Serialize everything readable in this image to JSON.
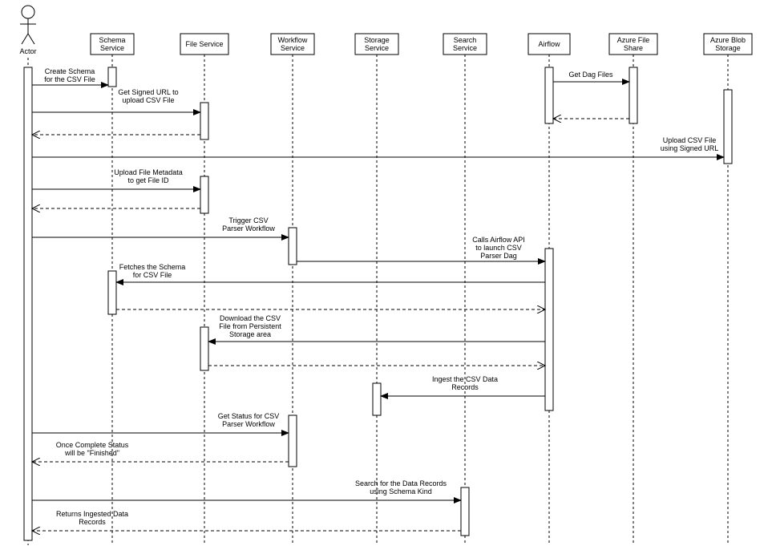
{
  "participants": {
    "actor": {
      "label1": "Actor",
      "label2": ""
    },
    "schema": {
      "label1": "Schema",
      "label2": "Service"
    },
    "file": {
      "label1": "File Service",
      "label2": ""
    },
    "workflow": {
      "label1": "Workflow",
      "label2": "Service"
    },
    "storage": {
      "label1": "Storage",
      "label2": "Service"
    },
    "search": {
      "label1": "Search",
      "label2": "Service"
    },
    "airflow": {
      "label1": "Airflow",
      "label2": ""
    },
    "azfile": {
      "label1": "Azure File",
      "label2": "Share"
    },
    "azblob": {
      "label1": "Azure Blob",
      "label2": "Storage"
    }
  },
  "messages": {
    "m1": {
      "line1": "Create Schema",
      "line2": "for the CSV File"
    },
    "m2": {
      "line1": "Get Dag Files",
      "line2": ""
    },
    "m3": {
      "line1": "Get Signed URL to",
      "line2": "upload CSV File"
    },
    "m4": {
      "line1": "Upload CSV File",
      "line2": "using Signed URL"
    },
    "m5": {
      "line1": "Upload File Metadata",
      "line2": "to get File ID"
    },
    "m6": {
      "line1": "Trigger CSV",
      "line2": "Parser Workflow"
    },
    "m7": {
      "line1": "Calls Airflow API",
      "line2": "to launch CSV",
      "line3": "Parser Dag"
    },
    "m8": {
      "line1": "Fetches the Schema",
      "line2": "for CSV File"
    },
    "m9": {
      "line1": "Download the CSV",
      "line2": "File from Persistent",
      "line3": "Storage area"
    },
    "m10": {
      "line1": "Ingest the CSV Data",
      "line2": "Records"
    },
    "m11": {
      "line1": "Get Status for CSV",
      "line2": "Parser Workflow"
    },
    "m12": {
      "line1": "Once Complete Status",
      "line2": "will be \"Finished\""
    },
    "m13": {
      "line1": "Search for the Data Records",
      "line2": "using Schema Kind"
    },
    "m14": {
      "line1": "Returns Ingested Data",
      "line2": "Records"
    }
  }
}
